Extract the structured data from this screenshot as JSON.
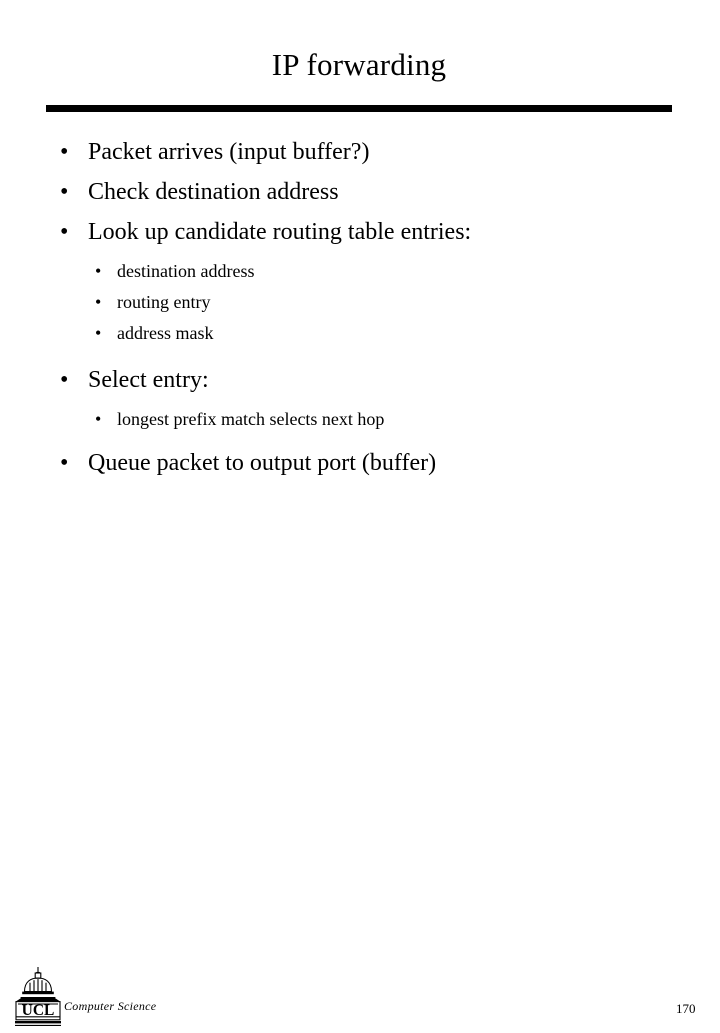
{
  "slide": {
    "title": "IP forwarding",
    "page_number": "170",
    "bullet_marker": "•",
    "bullets": [
      {
        "level": 1,
        "text": "Packet arrives (input buffer?)"
      },
      {
        "level": 1,
        "text": "Check destination address"
      },
      {
        "level": 1,
        "text": "Look up candidate routing table entries:"
      },
      {
        "level": 2,
        "text": "destination address"
      },
      {
        "level": 2,
        "text": "routing entry"
      },
      {
        "level": 2,
        "text": "address mask"
      },
      {
        "level": 1,
        "text": "Select entry:"
      },
      {
        "level": 2,
        "text": "longest prefix match selects next hop"
      },
      {
        "level": 1,
        "text": "Queue packet to output port (buffer)"
      }
    ]
  },
  "footer": {
    "logo_text": "UCL",
    "department": "Computer Science"
  },
  "colors": {
    "background": "#ffffff",
    "text": "#000000",
    "rule": "#000000"
  }
}
